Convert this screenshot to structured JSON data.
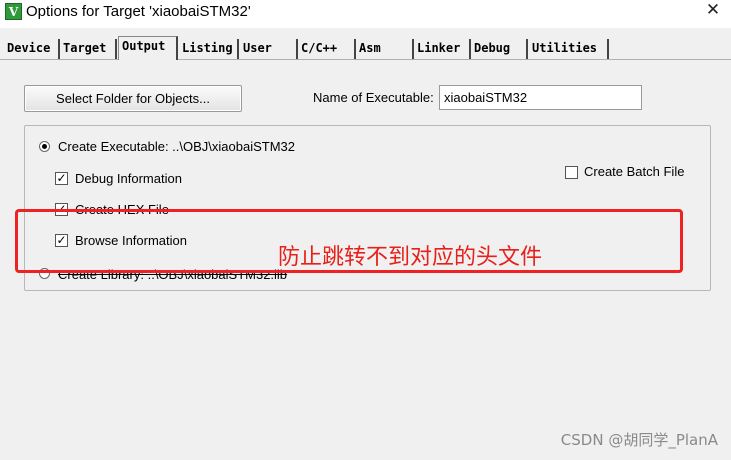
{
  "window": {
    "app_icon": "keil-uvision-icon",
    "title": "Options for Target 'xiaobaiSTM32'",
    "close_glyph": "✕"
  },
  "tabs": [
    {
      "label": "Device"
    },
    {
      "label": "Target"
    },
    {
      "label": "Output",
      "active": true
    },
    {
      "label": "Listing"
    },
    {
      "label": "User"
    },
    {
      "label": "C/C++"
    },
    {
      "label": "Asm"
    },
    {
      "label": "Linker"
    },
    {
      "label": "Debug"
    },
    {
      "label": "Utilities"
    }
  ],
  "output": {
    "select_folder_label": "Select Folder for Objects...",
    "name_label": "Name of Executable:",
    "name_value": "xiaobaiSTM32",
    "create_executable_label": "Create Executable:  ..\\OBJ\\xiaobaiSTM32",
    "create_executable_selected": true,
    "debug_info_label": "Debug Information",
    "debug_info_checked": true,
    "create_hex_label": "Create HEX File",
    "create_hex_checked": true,
    "browse_info_label": "Browse Information",
    "browse_info_checked": true,
    "create_library_label": "Create Library:  ..\\OBJ\\xiaobaiSTM32.lib",
    "create_library_selected": false,
    "create_batch_label": "Create Batch File",
    "create_batch_checked": false
  },
  "annotation": {
    "text": "防止跳转不到对应的头文件",
    "color": "#e8201a"
  },
  "watermark": "CSDN @胡同学_PlanA"
}
